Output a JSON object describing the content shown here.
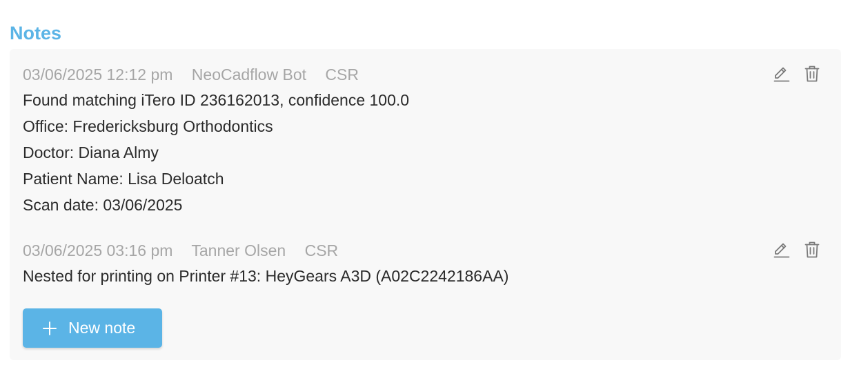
{
  "section": {
    "title": "Notes"
  },
  "notes": [
    {
      "date": "03/06/2025 12:12 pm",
      "author": "NeoCadflow Bot",
      "role": "CSR",
      "lines": [
        "Found matching iTero ID 236162013, confidence 100.0",
        "Office: Fredericksburg Orthodontics",
        "Doctor: Diana Almy",
        "Patient Name: Lisa Deloatch",
        "Scan date: 03/06/2025"
      ],
      "actions": {
        "edit_icon": "pencil-icon",
        "delete_icon": "trash-icon"
      }
    },
    {
      "date": "03/06/2025 03:16 pm",
      "author": "Tanner Olsen",
      "role": "CSR",
      "lines": [
        "Nested for printing on Printer #13: HeyGears A3D (A02C2242186AA)"
      ],
      "actions": {
        "edit_icon": "pencil-icon",
        "delete_icon": "trash-icon"
      }
    }
  ],
  "new_note_button": {
    "label": "New note",
    "icon": "plus-icon"
  },
  "colors": {
    "accent": "#5bb4e6",
    "panel_bg": "#f8f8f8",
    "meta_text": "#a6a6a6",
    "body_text": "#2b2b2b",
    "icon": "#7a7a7a"
  }
}
